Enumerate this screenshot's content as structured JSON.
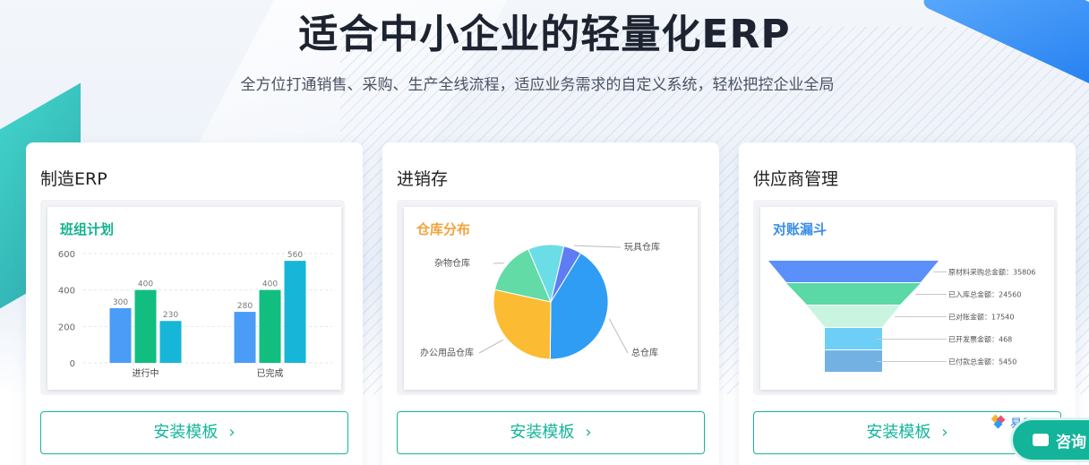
{
  "header": {
    "title": "适合中小企业的轻量化ERP",
    "subtitle": "全方位打通销售、采购、生产全线流程，适应业务需求的自定义系统，轻松把控企业全局"
  },
  "colors": {
    "accent": "#15b59a",
    "teal_title": "#12b38d",
    "orange_title": "#f3a23a",
    "blue_title": "#3a8ee6"
  },
  "cards": [
    {
      "title": "制造ERP",
      "panel_title": "班组计划",
      "button": "安装模板",
      "chevron": "›"
    },
    {
      "title": "进销存",
      "panel_title": "仓库分布",
      "button": "安装模板",
      "chevron": "›"
    },
    {
      "title": "供应商管理",
      "panel_title": "对账漏斗",
      "button": "安装模板",
      "chevron": "›"
    }
  ],
  "chart_data": [
    {
      "type": "bar",
      "categories": [
        "进行中",
        "已完成"
      ],
      "series": [
        {
          "values": [
            300,
            280
          ],
          "color": "#4a9cf7"
        },
        {
          "values": [
            400,
            400
          ],
          "color": "#12be7f"
        },
        {
          "values": [
            230,
            560
          ],
          "color": "#17b6d8"
        }
      ],
      "yticks": [
        "0",
        "200",
        "400",
        "600"
      ],
      "ylim": [
        0,
        600
      ]
    },
    {
      "type": "pie",
      "slices": [
        {
          "label": "总仓库",
          "value": 41,
          "color": "#2f9df4"
        },
        {
          "label": "办公用品仓库",
          "value": 28,
          "color": "#fbbb33"
        },
        {
          "label": "杂物仓库",
          "value": 15,
          "color": "#62dba6"
        },
        {
          "label": "",
          "value": 10,
          "color": "#6bdde6"
        },
        {
          "label": "玩具仓库",
          "value": 5,
          "color": "#5f7df2"
        }
      ]
    },
    {
      "type": "funnel",
      "stages": [
        {
          "label": "原材料采购总金额：35806",
          "value": 35806,
          "color": "#5b8ff9"
        },
        {
          "label": "已入库总金额：24560",
          "value": 24560,
          "color": "#5ad8a6"
        },
        {
          "label": "已对账金额：17540",
          "value": 17540,
          "color": "#c9f5e0"
        },
        {
          "label": "已开发票金额：468",
          "value": 468,
          "color": "#6dcff6"
        },
        {
          "label": "已付款总金额：5450",
          "value": 5450,
          "color": "#74b1e3"
        }
      ]
    }
  ],
  "widgets": {
    "brand": "易呈软件",
    "consult": "咨询"
  }
}
